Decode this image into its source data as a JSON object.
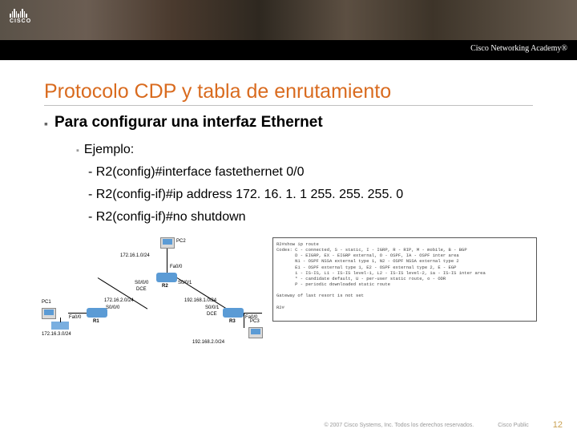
{
  "header": {
    "logo_text": "CISCO",
    "academy": "Cisco Networking Academy®"
  },
  "title": "Protocolo CDP y tabla de enrutamiento",
  "main_bullet": "Para configurar una interfaz Ethernet",
  "sub_bullet": "Ejemplo:",
  "code_lines": [
    "- R2(config)#interface fastethernet 0/0",
    "- R2(config-if)#ip address 172. 16. 1. 1 255. 255. 255. 0",
    "- R2(config-if)#no shutdown"
  ],
  "diagram": {
    "pcs": [
      "PC1",
      "PC2",
      "PC3"
    ],
    "routers": [
      "R1",
      "R2",
      "R3"
    ],
    "nets": {
      "top": "172.16.1.0/24",
      "left_mid": "172.16.2.0/24",
      "right_mid": "192.168.1.0/24",
      "left_bot": "172.16.3.0/24",
      "right_bot": "192.168.2.0/24"
    },
    "ifaces": {
      "fa00": "Fa0/0",
      "s000": "S0/0/0",
      "s001": "S0/0/1",
      "dce": "DCE"
    }
  },
  "routebox": {
    "line1": "R2#show ip route",
    "line2": "Codes: C - connected, S - static, I - IGRP, R - RIP, M - mobile, B - BGP",
    "line3": "       D - EIGRP, EX - EIGRP external, O - OSPF, IA - OSPF inter area",
    "line4": "       N1 - OSPF NSSA external type 1, N2 - OSPF NSSA external type 2",
    "line5": "       E1 - OSPF external type 1, E2 - OSPF external type 2, E - EGP",
    "line6": "       i - IS-IS, L1 - IS-IS level-1, L2 - IS-IS level-2, ia - IS-IS inter area",
    "line7": "       * - candidate default, U - per-user static route, o - ODR",
    "line8": "       P - periodic downloaded static route",
    "line9": "",
    "line10": "Gateway of last resort is not set",
    "line11": "",
    "line12": "R2#"
  },
  "footer": {
    "copyright": "© 2007 Cisco Systems, Inc. Todos los derechos reservados.",
    "public": "Cisco Public",
    "page": "12"
  }
}
